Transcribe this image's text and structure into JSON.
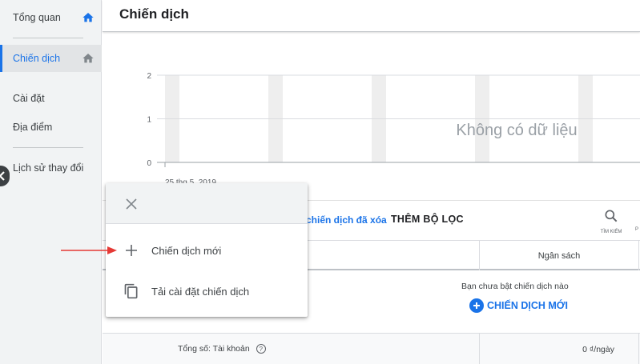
{
  "sidebar": {
    "items": [
      {
        "label": "Tổng quan"
      },
      {
        "label": "Chiến dịch"
      },
      {
        "label": "Cài đặt"
      },
      {
        "label": "Địa điểm"
      },
      {
        "label": "Lịch sử thay đổi"
      }
    ]
  },
  "header": {
    "title": "Chiến dịch"
  },
  "chart_data": {
    "type": "bar",
    "y_ticks": [
      "2",
      "1",
      "0"
    ],
    "ylim": [
      0,
      2
    ],
    "x_label_first": "25 thg 5, 2019",
    "empty_message": "Không có dữ liệu"
  },
  "filterbar": {
    "chip": "chiến dịch đã xóa",
    "add_filter": "THÊM BỘ LỌC",
    "search_label": "TÌM KIẾM",
    "extra_label": "P"
  },
  "table": {
    "col_budget": "Ngân sách",
    "empty_message": "Bạn chưa bật chiến dịch nào",
    "new_campaign": "CHIẾN DỊCH MỚI",
    "totals_label": "Tổng số: Tài khoản",
    "totals_budget": "0 ₫/ngày"
  },
  "popup": {
    "items": [
      {
        "label": "Chiến dịch mới"
      },
      {
        "label": "Tải cài đặt chiến dịch"
      }
    ]
  },
  "colors": {
    "accent": "#1a73e8",
    "annotation": "#e53935"
  }
}
